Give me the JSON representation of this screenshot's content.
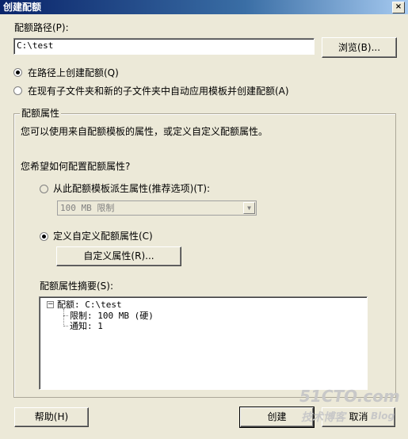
{
  "window": {
    "title": "创建配额",
    "close_glyph": "×"
  },
  "path": {
    "label": "配额路径(P):",
    "value": "C:\\test",
    "browse_label": "浏览(B)..."
  },
  "options": [
    {
      "label": "在路径上创建配额(Q)",
      "selected": true
    },
    {
      "label": "在现有子文件夹和新的子文件夹中自动应用模板并创建配额(A)",
      "selected": false
    }
  ],
  "properties": {
    "group_title": "配额属性",
    "description": "您可以使用来自配额模板的属性，或定义自定义配额属性。",
    "question": "您希望如何配置配额属性?",
    "from_template_label": "从此配额模板派生属性(推荐选项)(T):",
    "template_selected": "100 MB 限制",
    "custom_label": "定义自定义配额属性(C)",
    "custom_button": "自定义属性(R)...",
    "summary_label": "配额属性摘要(S):",
    "summary": {
      "root": "配额: C:\\test",
      "children": [
        "限制: 100 MB (硬)",
        "通知: 1"
      ]
    }
  },
  "footer": {
    "help": "帮助(H)",
    "create": "创建",
    "cancel": "取消"
  },
  "watermark": {
    "line1": "51CTO.com",
    "line2": "技术博客",
    "line3": "Blog"
  }
}
